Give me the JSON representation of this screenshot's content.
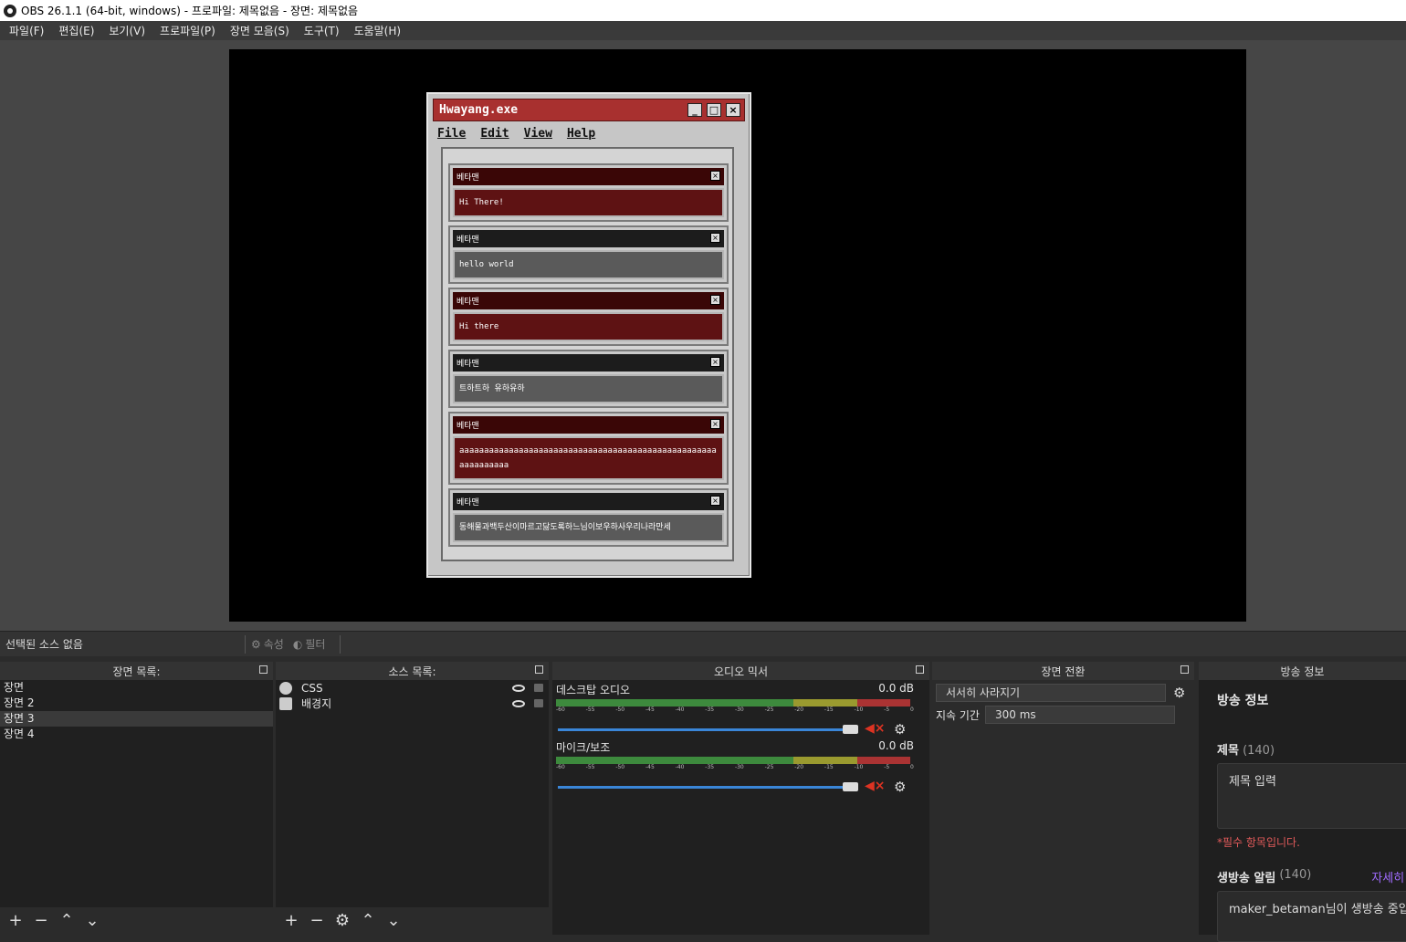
{
  "window": {
    "title": "OBS 26.1.1 (64-bit, windows) - 프로파일: 제목없음 - 장면: 제목없음"
  },
  "menu": [
    "파일(F)",
    "편집(E)",
    "보기(V)",
    "프로파일(P)",
    "장면 모음(S)",
    "도구(T)",
    "도움말(H)"
  ],
  "preview_window": {
    "title": "Hwayang.exe",
    "menu": [
      "File",
      "Edit",
      "View",
      "Help"
    ],
    "messages": [
      {
        "user": "베타맨",
        "text": "Hi There!"
      },
      {
        "user": "베타맨",
        "text": "hello world"
      },
      {
        "user": "베타맨",
        "text": "Hi there"
      },
      {
        "user": "베타맨",
        "text": "트하트하 유하유하"
      },
      {
        "user": "베타맨",
        "text": "aaaaaaaaaaaaaaaaaaaaaaaaaaaaaaaaaaaaaaaaaaaaaaaaaaaaaaaaaaaaaa"
      },
      {
        "user": "베타맨",
        "text": "동해물과백두산이마르고닳도록하느님이보우하사우리나라만세"
      }
    ],
    "colors": {
      "red_header": "#3a0606",
      "red_body": "#5e1213",
      "title_bar": "#a8302f"
    }
  },
  "props": {
    "selected": "선택된 소스 없음",
    "properties": "속성",
    "filters": "필터"
  },
  "scenes": {
    "header": "장면 목록:",
    "items": [
      "장면",
      "장면 2",
      "장면 3",
      "장면 4"
    ],
    "selected_index": 2
  },
  "sources": {
    "header": "소스 목록:",
    "items": [
      "CSS",
      "배경지"
    ]
  },
  "mixer": {
    "header": "오디오 믹서",
    "channels": [
      {
        "name": "데스크탑 오디오",
        "db": "0.0 dB"
      },
      {
        "name": "마이크/보조",
        "db": "0.0 dB"
      }
    ],
    "ticks": [
      "-60",
      "-55",
      "-50",
      "-45",
      "-40",
      "-35",
      "-30",
      "-25",
      "-20",
      "-15",
      "-10",
      "-5",
      "0"
    ]
  },
  "transitions": {
    "header": "장면 전환",
    "selected": "서서히 사라지기",
    "duration_label": "지속 기간",
    "duration": "300 ms"
  },
  "broadcast": {
    "header": "방송 정보",
    "title": "방송 정보",
    "title_label": "제목",
    "title_count": "(140)",
    "title_placeholder": "제목 입력",
    "required": "*필수 항목입니다.",
    "notify_label": "생방송 알림",
    "notify_count": "(140)",
    "details": "자세히",
    "notify_text": "maker_betaman님이 생방송 중입"
  }
}
